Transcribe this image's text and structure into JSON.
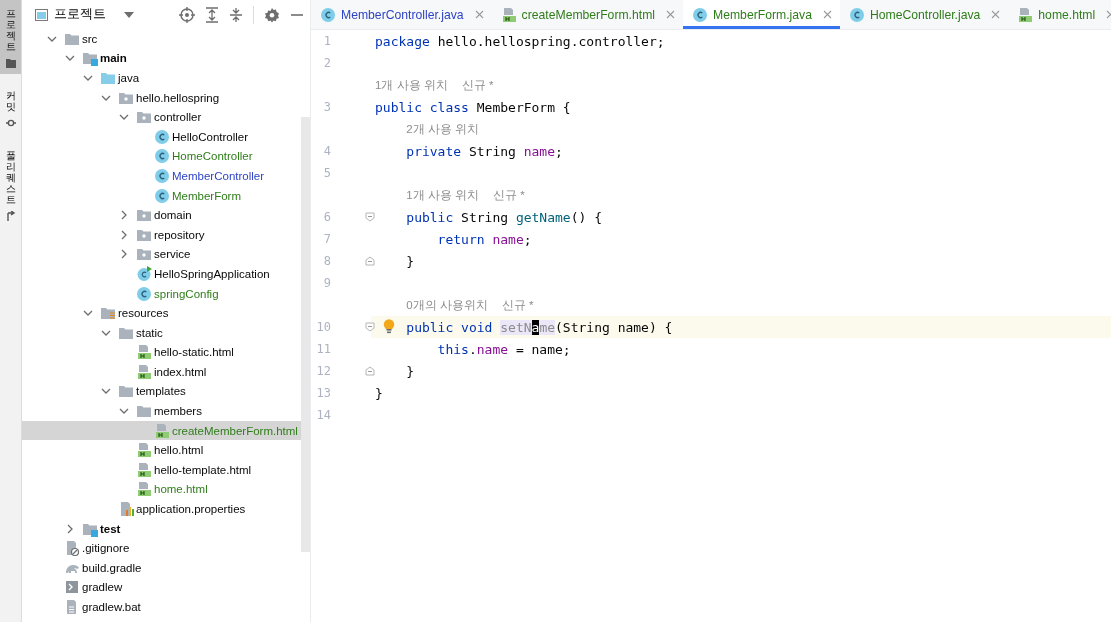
{
  "tool_strip": [
    {
      "label": "프로젝트",
      "selected": true
    },
    {
      "label": "커밋",
      "selected": false
    },
    {
      "label": "풀 리퀘스트",
      "selected": false
    }
  ],
  "project_panel": {
    "title": "프로젝트",
    "tree": [
      {
        "label": "src",
        "kind": "folder",
        "selected": false,
        "expanded": true,
        "children": [
          {
            "label": "main",
            "kind": "sourceroot",
            "selected": false,
            "expanded": true,
            "children": [
              {
                "label": "java",
                "kind": "javafolder",
                "selected": false,
                "expanded": true,
                "children": [
                  {
                    "label": "hello.hellospring",
                    "kind": "package",
                    "selected": false,
                    "expanded": true,
                    "children": [
                      {
                        "label": "controller",
                        "kind": "package",
                        "selected": false,
                        "expanded": true,
                        "children": [
                          {
                            "label": "HelloController",
                            "kind": "class",
                            "selected": false
                          },
                          {
                            "label": "HomeController",
                            "kind": "class",
                            "color": "#2f7d1a",
                            "selected": false
                          },
                          {
                            "label": "MemberController",
                            "kind": "class",
                            "color": "#2f44c4",
                            "selected": false
                          },
                          {
                            "label": "MemberForm",
                            "kind": "class",
                            "color": "#2f7d1a",
                            "selected": false
                          }
                        ]
                      },
                      {
                        "label": "domain",
                        "kind": "package",
                        "selected": false,
                        "expanded": false
                      },
                      {
                        "label": "repository",
                        "kind": "package",
                        "selected": false,
                        "expanded": false
                      },
                      {
                        "label": "service",
                        "kind": "package",
                        "selected": false,
                        "expanded": false
                      },
                      {
                        "label": "HelloSpringApplication",
                        "kind": "app",
                        "selected": false
                      },
                      {
                        "label": "springConfig",
                        "kind": "class",
                        "color": "#2f7d1a",
                        "selected": false
                      }
                    ]
                  }
                ]
              },
              {
                "label": "resources",
                "kind": "resources",
                "selected": false,
                "expanded": true,
                "children": [
                  {
                    "label": "static",
                    "kind": "folder",
                    "selected": false,
                    "expanded": true,
                    "children": [
                      {
                        "label": "hello-static.html",
                        "kind": "html",
                        "selected": false
                      },
                      {
                        "label": "index.html",
                        "kind": "html",
                        "selected": false
                      }
                    ]
                  },
                  {
                    "label": "templates",
                    "kind": "folder",
                    "selected": false,
                    "expanded": true,
                    "children": [
                      {
                        "label": "members",
                        "kind": "folder",
                        "selected": false,
                        "expanded": true,
                        "children": [
                          {
                            "label": "createMemberForm.html",
                            "kind": "html",
                            "color": "#2f7d1a",
                            "selected": true
                          }
                        ]
                      },
                      {
                        "label": "hello.html",
                        "kind": "html",
                        "selected": false
                      },
                      {
                        "label": "hello-template.html",
                        "kind": "html",
                        "selected": false
                      },
                      {
                        "label": "home.html",
                        "kind": "html",
                        "color": "#2f7d1a",
                        "selected": false
                      }
                    ]
                  },
                  {
                    "label": "application.properties",
                    "kind": "properties",
                    "selected": false
                  }
                ]
              }
            ]
          },
          {
            "label": "test",
            "kind": "sourceroot",
            "selected": false,
            "expanded": false
          }
        ]
      },
      {
        "label": ".gitignore",
        "kind": "gitignore",
        "selected": false
      },
      {
        "label": "build.gradle",
        "kind": "gradle",
        "selected": false
      },
      {
        "label": "gradlew",
        "kind": "script",
        "selected": false
      },
      {
        "label": "gradlew.bat",
        "kind": "textfile",
        "selected": false
      }
    ]
  },
  "editor": {
    "tabs": [
      {
        "label": "MemberController.java",
        "kind": "class",
        "color": "#2f44c4",
        "selected": false
      },
      {
        "label": "createMemberForm.html",
        "kind": "html",
        "color": "#2f7d1a",
        "selected": false
      },
      {
        "label": "MemberForm.java",
        "kind": "class",
        "color": "#2f7d1a",
        "selected": true
      },
      {
        "label": "HomeController.java",
        "kind": "class",
        "color": "#2f7d1a",
        "selected": false
      },
      {
        "label": "home.html",
        "kind": "html",
        "color": "#2f7d1a",
        "selected": false
      }
    ],
    "lines": [
      {
        "kind": "code",
        "number": "1",
        "current": false,
        "fold_open": false,
        "fold_close": false,
        "bulb": false,
        "tokens": [
          {
            "text": "package ",
            "kind": "keyword"
          },
          {
            "text": "hello.hellospring.controller;",
            "kind": "plain"
          }
        ]
      },
      {
        "kind": "code",
        "number": "2",
        "current": false,
        "fold_open": false,
        "fold_close": false,
        "bulb": false
      },
      {
        "kind": "hint",
        "tokens": [
          {
            "text": "1개 사용 위치",
            "kind": "usages"
          },
          {
            "text": "신규 *",
            "kind": "author"
          }
        ]
      },
      {
        "kind": "code",
        "number": "3",
        "current": false,
        "fold_open": false,
        "fold_close": false,
        "bulb": false,
        "tokens": [
          {
            "text": "public class ",
            "kind": "keyword"
          },
          {
            "text": "MemberForm {",
            "kind": "plain"
          }
        ]
      },
      {
        "kind": "hint",
        "tokens": [
          {
            "text": "2개 사용 위치",
            "kind": "usages"
          }
        ]
      },
      {
        "kind": "code",
        "number": "4",
        "current": false,
        "fold_open": false,
        "fold_close": false,
        "bulb": false,
        "tokens": [
          {
            "text": "    private ",
            "kind": "keyword"
          },
          {
            "text": "String ",
            "kind": "plain"
          },
          {
            "text": "name",
            "kind": "field"
          },
          {
            "text": ";",
            "kind": "plain"
          }
        ]
      },
      {
        "kind": "code",
        "number": "5",
        "current": false,
        "fold_open": false,
        "fold_close": false,
        "bulb": false
      },
      {
        "kind": "hint",
        "tokens": [
          {
            "text": "1개 사용 위치",
            "kind": "usages"
          },
          {
            "text": "신규 *",
            "kind": "author"
          }
        ]
      },
      {
        "kind": "code",
        "number": "6",
        "current": false,
        "fold_open": true,
        "fold_close": false,
        "bulb": false,
        "tokens": [
          {
            "text": "    public ",
            "kind": "keyword"
          },
          {
            "text": "String ",
            "kind": "plain"
          },
          {
            "text": "getName",
            "kind": "method"
          },
          {
            "text": "() {",
            "kind": "plain"
          }
        ]
      },
      {
        "kind": "code",
        "number": "7",
        "current": false,
        "fold_open": false,
        "fold_close": false,
        "bulb": false,
        "tokens": [
          {
            "text": "        return ",
            "kind": "keyword"
          },
          {
            "text": "name",
            "kind": "field"
          },
          {
            "text": ";",
            "kind": "plain"
          }
        ]
      },
      {
        "kind": "code",
        "number": "8",
        "current": false,
        "fold_open": false,
        "fold_close": true,
        "bulb": false,
        "tokens": [
          {
            "text": "    }",
            "kind": "plain"
          }
        ]
      },
      {
        "kind": "code",
        "number": "9",
        "current": false,
        "fold_open": false,
        "fold_close": false,
        "bulb": false
      },
      {
        "kind": "hint",
        "tokens": [
          {
            "text": "0개의 사용위치",
            "kind": "usages"
          },
          {
            "text": "신규 *",
            "kind": "author"
          }
        ]
      },
      {
        "kind": "code",
        "number": "10",
        "current": true,
        "fold_open": true,
        "fold_close": false,
        "bulb": true,
        "tokens": [
          {
            "text": "    public void ",
            "kind": "keyword"
          },
          {
            "text": "setN",
            "kind": "unused"
          },
          {
            "text": "a",
            "kind": "caret"
          },
          {
            "text": "me",
            "kind": "unused"
          },
          {
            "text": "(String name) {",
            "kind": "plain"
          }
        ]
      },
      {
        "kind": "code",
        "number": "11",
        "current": false,
        "fold_open": false,
        "fold_close": false,
        "bulb": false,
        "tokens": [
          {
            "text": "        this",
            "kind": "keyword"
          },
          {
            "text": ".",
            "kind": "plain"
          },
          {
            "text": "name",
            "kind": "field"
          },
          {
            "text": " = name;",
            "kind": "plain"
          }
        ]
      },
      {
        "kind": "code",
        "number": "12",
        "current": false,
        "fold_open": false,
        "fold_close": true,
        "bulb": false,
        "tokens": [
          {
            "text": "    }",
            "kind": "plain"
          }
        ]
      },
      {
        "kind": "code",
        "number": "13",
        "current": false,
        "fold_open": false,
        "fold_close": false,
        "bulb": false,
        "tokens": [
          {
            "text": "}",
            "kind": "plain"
          }
        ]
      },
      {
        "kind": "code",
        "number": "14",
        "current": false,
        "fold_open": false,
        "fold_close": false,
        "bulb": false
      }
    ]
  }
}
